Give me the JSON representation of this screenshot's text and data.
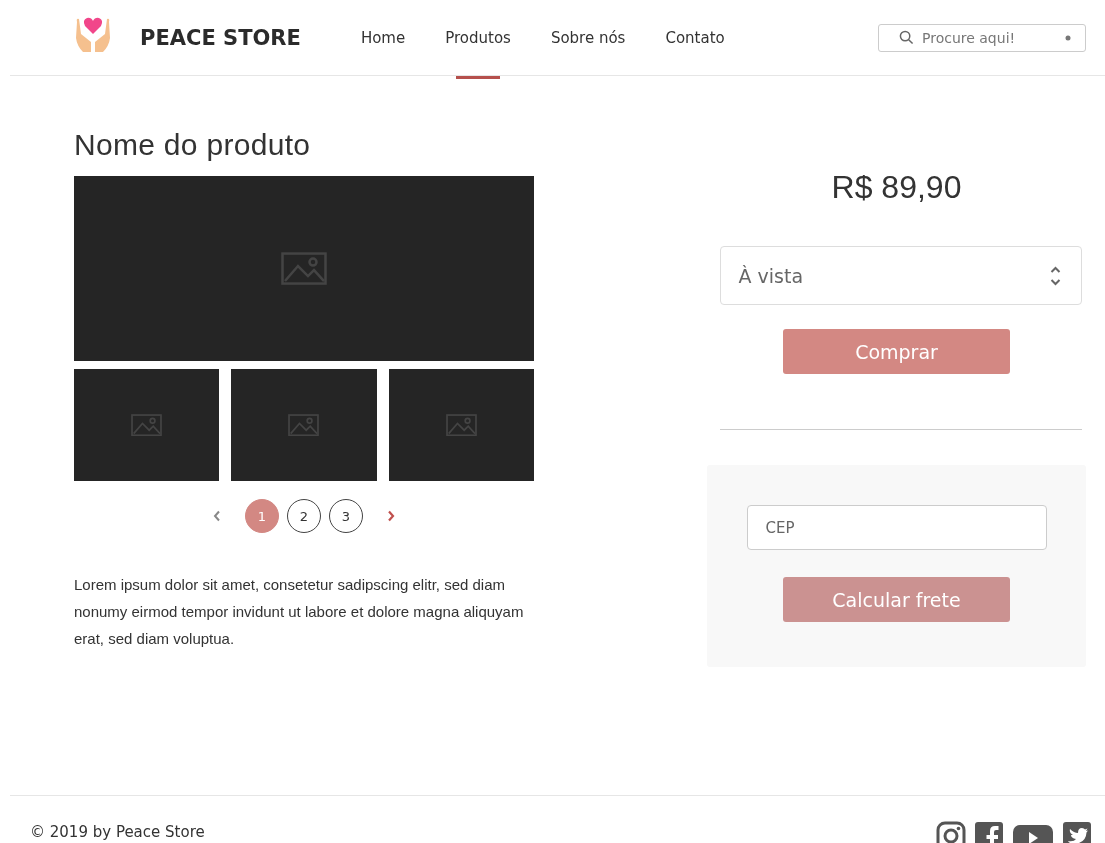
{
  "header": {
    "brand": "PEACE STORE",
    "nav": [
      {
        "label": "Home",
        "selected": false
      },
      {
        "label": "Produtos",
        "selected": true
      },
      {
        "label": "Sobre nós",
        "selected": false
      },
      {
        "label": "Contato",
        "selected": false
      }
    ],
    "search": {
      "placeholder": "Procure aqui!"
    }
  },
  "product": {
    "title": "Nome do produto",
    "pages": [
      {
        "label": "1",
        "selected": true
      },
      {
        "label": "2",
        "selected": false
      },
      {
        "label": "3",
        "selected": false
      }
    ],
    "description": "Lorem ipsum dolor sit amet, consetetur sadipscing elitr, sed diam nonumy eirmod tempor invidunt ut labore et dolore magna aliquyam erat, sed diam voluptua."
  },
  "purchase": {
    "price": "R$ 89,90",
    "payment": "À vista",
    "buy_button": "Comprar"
  },
  "shipping": {
    "placeholder": "CEP",
    "button": "Calcular frete"
  },
  "footer": {
    "copyright": "© 2019 by Peace Store"
  }
}
